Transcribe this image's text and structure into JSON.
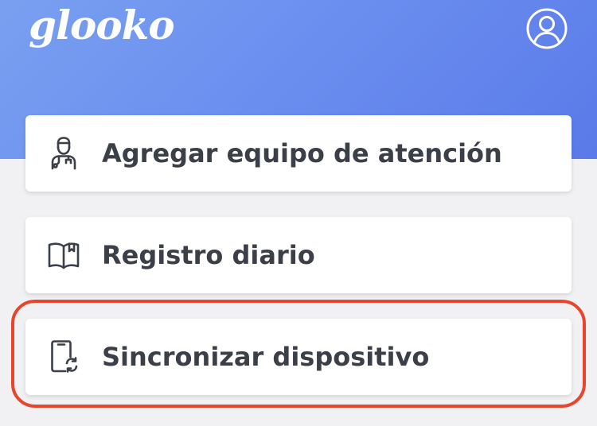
{
  "header": {
    "logo_text": "glooko",
    "profile_icon": "user-circle-icon"
  },
  "menu": {
    "items": [
      {
        "label": "Agregar equipo de atención",
        "icon": "doctor-icon"
      },
      {
        "label": "Registro diario",
        "icon": "book-icon"
      },
      {
        "label": "Sincronizar dispositivo",
        "icon": "phone-sync-icon"
      }
    ]
  },
  "colors": {
    "header_gradient_start": "#79a0f0",
    "header_gradient_end": "#5a7ae8",
    "background": "#f1f1f3",
    "card": "#ffffff",
    "label_text": "#3b3f47",
    "highlight": "#e8462c"
  }
}
